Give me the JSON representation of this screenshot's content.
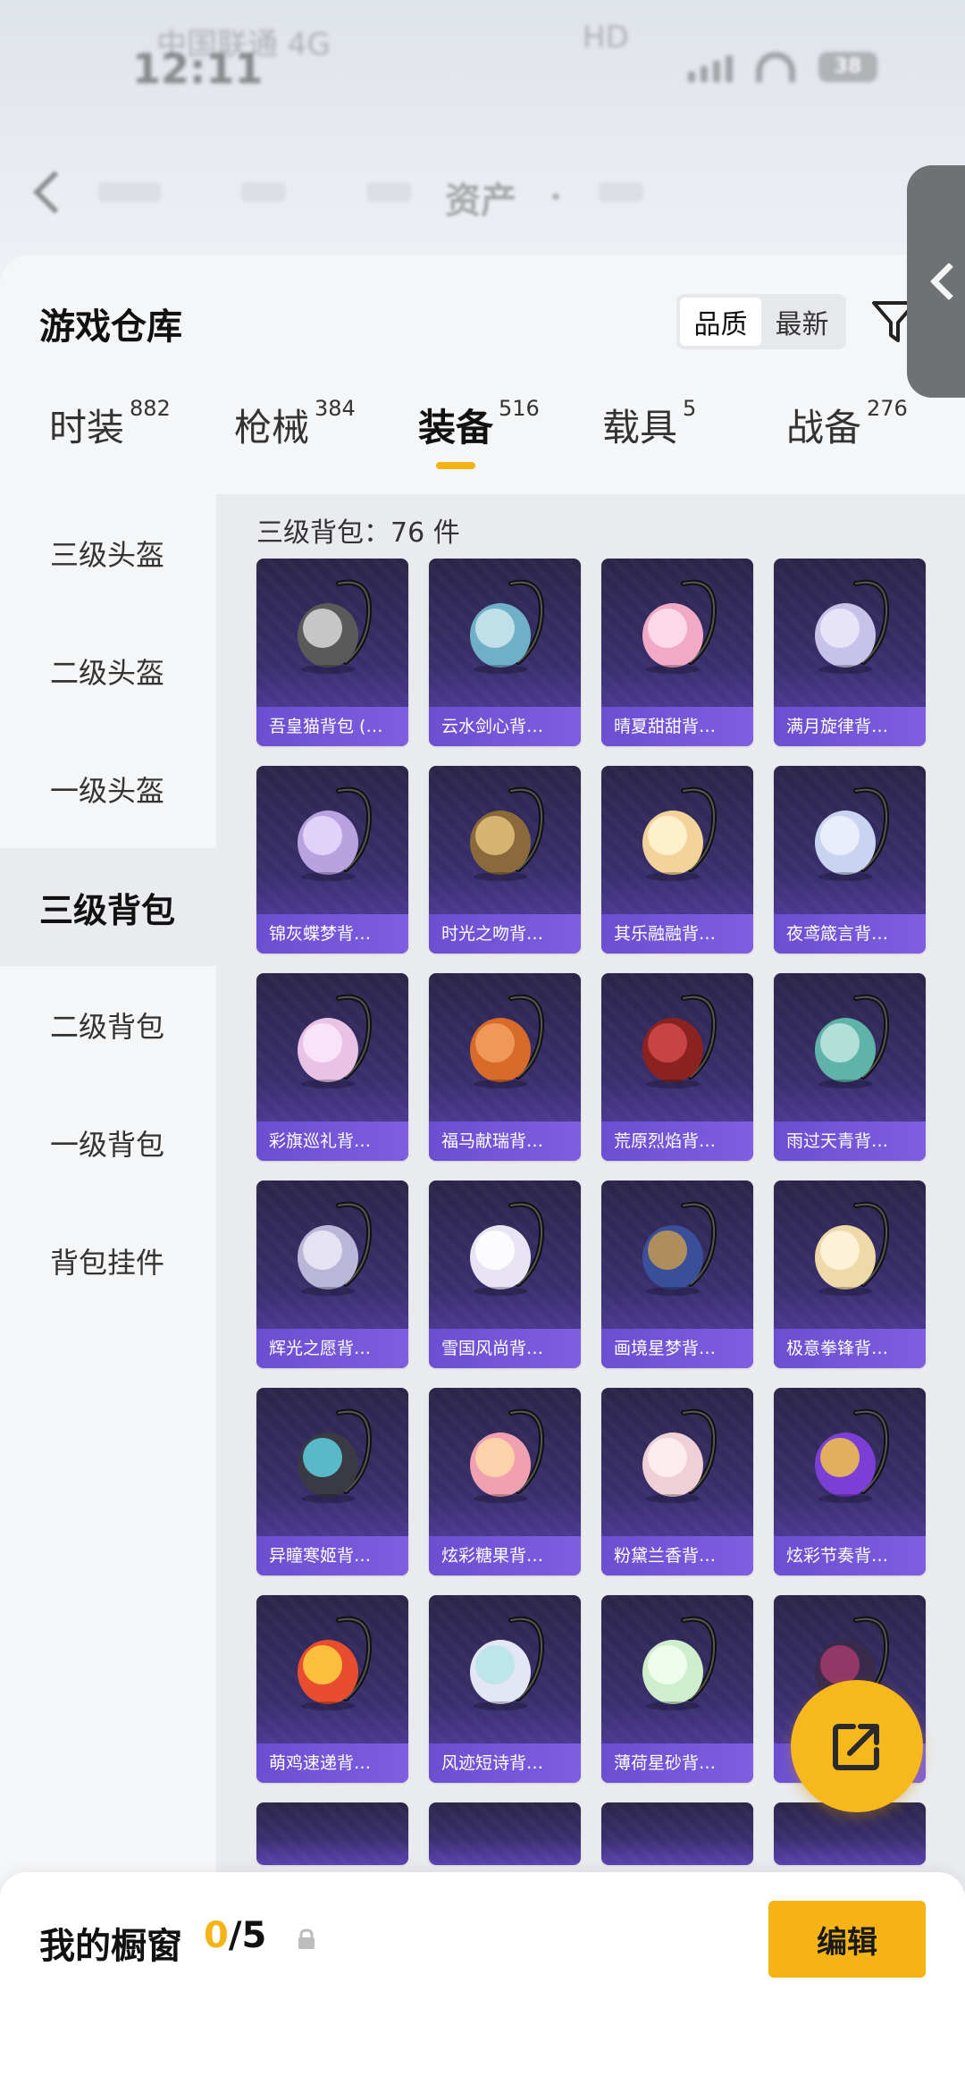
{
  "status_bar": {
    "time": "12:11",
    "carrier": "中国联通 4G",
    "carrier2": "HD",
    "battery": "38"
  },
  "nav": {
    "title": "资产"
  },
  "warehouse": {
    "title": "游戏仓库",
    "sort_options": [
      "品质",
      "最新"
    ],
    "active_sort": "品质"
  },
  "category_tabs": [
    {
      "label": "时装",
      "count": "882"
    },
    {
      "label": "枪械",
      "count": "384"
    },
    {
      "label": "装备",
      "count": "516"
    },
    {
      "label": "载具",
      "count": "5"
    },
    {
      "label": "战备",
      "count": "276"
    }
  ],
  "active_category": "装备",
  "subcategories": [
    "三级头盔",
    "二级头盔",
    "一级头盔",
    "三级背包",
    "二级背包",
    "一级背包",
    "背包挂件"
  ],
  "active_subcategory": "三级背包",
  "grid": {
    "header": "三级背包：76 件",
    "items": [
      "吾皇猫背包 (…",
      "云水剑心背…",
      "晴夏甜甜背…",
      "满月旋律背…",
      "锦灰蝶梦背…",
      "时光之吻背…",
      "其乐融融背…",
      "夜鸢箴言背…",
      "彩旗巡礼背…",
      "福马献瑞背…",
      "荒原烈焰背…",
      "雨过天青背…",
      "辉光之愿背…",
      "雪国风尚背…",
      "画境星梦背…",
      "极意拳锋背…",
      "异瞳寒姬背…",
      "炫彩糖果背…",
      "粉黛兰香背…",
      "炫彩节奏背…",
      "萌鸡速递背…",
      "风迹短诗背…",
      "薄荷星砂背…",
      ""
    ]
  },
  "showcase": {
    "label": "我的橱窗",
    "current": "0",
    "total": "/5",
    "edit_label": "编辑"
  },
  "icons": {
    "back": "chevron-left-icon",
    "filter": "filter-icon",
    "share": "share-export-icon",
    "lock": "lock-icon"
  },
  "colors": {
    "accent": "#f5b316",
    "card_top": "#2b2549",
    "card_bottom": "#5b42b0",
    "card_name_bar": "#6b4fd0"
  }
}
